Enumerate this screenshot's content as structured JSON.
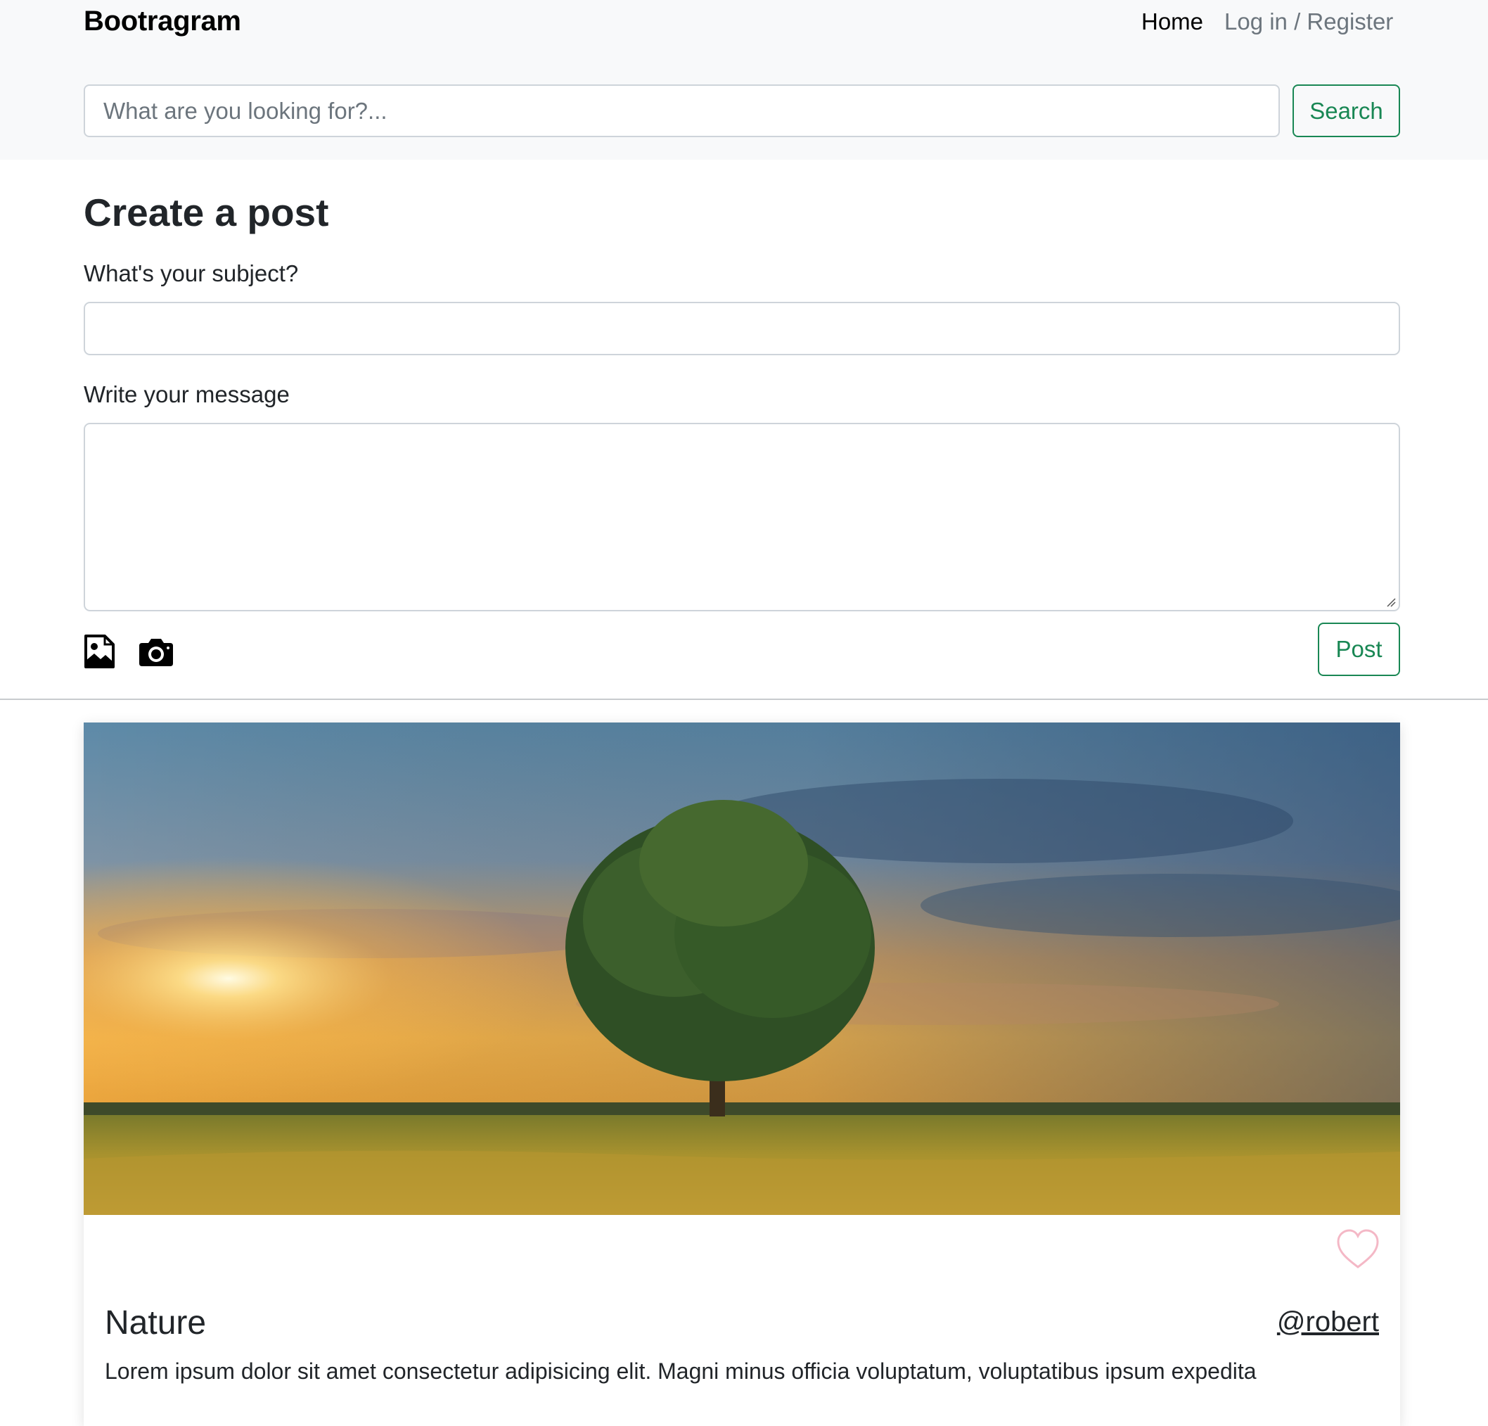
{
  "navbar": {
    "brand": "Bootragram",
    "links": [
      {
        "label": "Home"
      },
      {
        "label": "Log in / Register"
      }
    ]
  },
  "search": {
    "placeholder": "What are you looking for?...",
    "value": "",
    "button_label": "Search"
  },
  "create_post": {
    "title": "Create a post",
    "subject_label": "What's your subject?",
    "subject_value": "",
    "message_label": "Write your message",
    "message_value": "",
    "attach_image_icon": "image-icon",
    "camera_icon": "camera-icon",
    "post_button": "Post"
  },
  "feed": {
    "posts": [
      {
        "title": "Nature",
        "author": "@robert",
        "text": "Lorem ipsum dolor sit amet consectetur adipisicing elit. Magni minus officia voluptatum, voluptatibus ipsum expedita",
        "like_icon": "heart-icon",
        "liked": false
      }
    ]
  },
  "colors": {
    "accent": "#198754",
    "navbar_bg": "#f8f9fa",
    "heart": "#f4b8c6"
  }
}
